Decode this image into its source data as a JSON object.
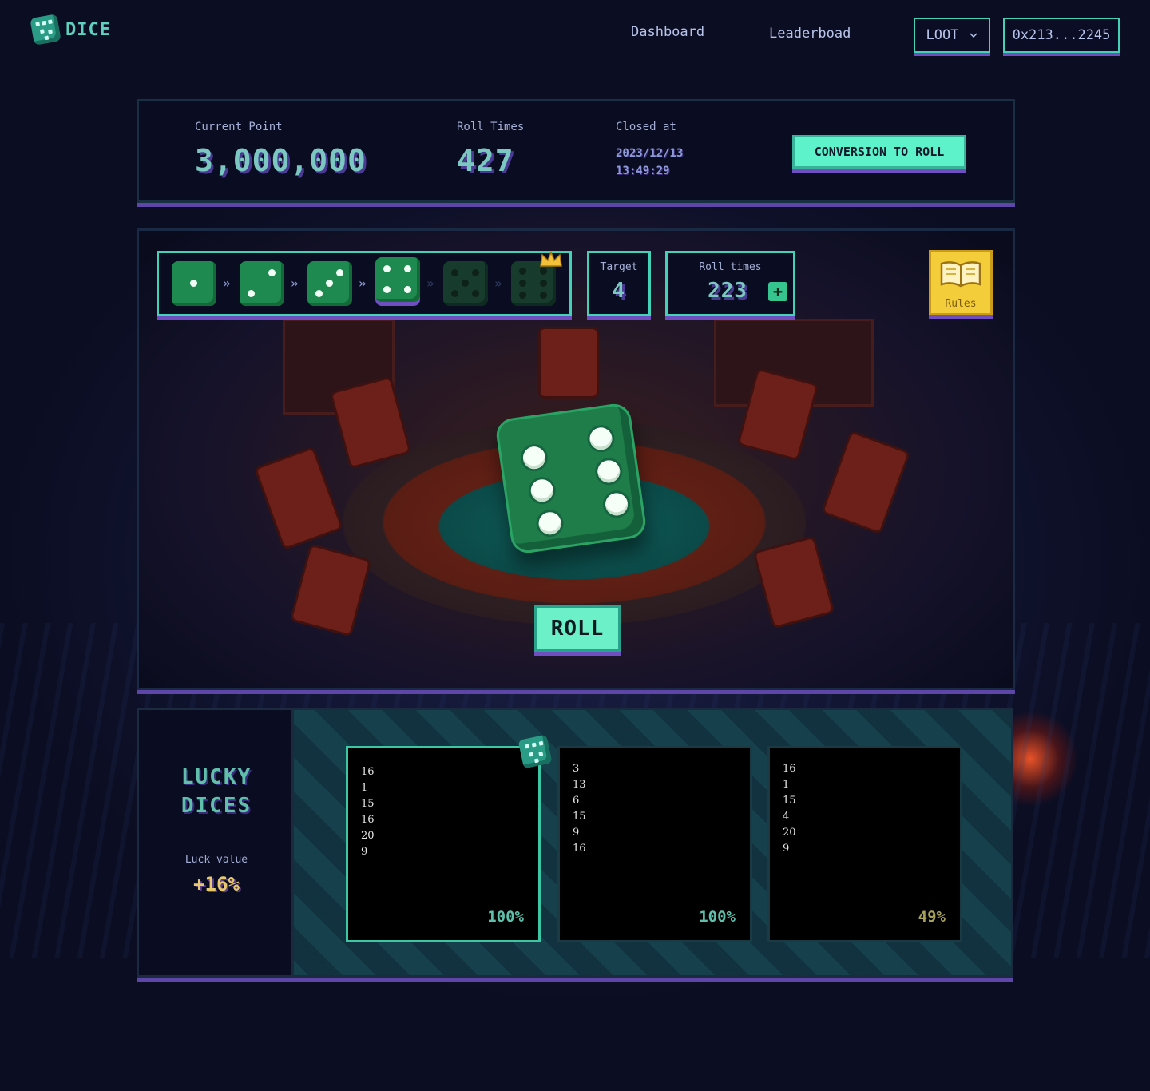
{
  "brand": {
    "name": "DICE",
    "logo_icon": "dice-icon"
  },
  "nav": {
    "links": [
      "Dashboard",
      "Leaderboad"
    ],
    "token_select": "LOOT",
    "wallet": "0x213...2245"
  },
  "stats": {
    "current_point_label": "Current Point",
    "current_point": "3,000,000",
    "roll_times_label": "Roll Times",
    "roll_times": "427",
    "closed_at_label": "Closed at",
    "closed_date": "2023/12/13",
    "closed_time": "13:49:29",
    "conversion_button": "CONVERSION TO ROLL"
  },
  "game": {
    "sequence": [
      1,
      2,
      3,
      4,
      5,
      6
    ],
    "current_step": 4,
    "target_label": "Target",
    "target": "4",
    "roll_times_label": "Roll times",
    "roll_times": "223",
    "rules_label": "Rules",
    "current_roll": 6,
    "roll_button": "ROLL"
  },
  "lucky": {
    "title_line1": "LUCKY",
    "title_line2": "DICES",
    "luck_label": "Luck value",
    "luck_value": "+16%",
    "cards": [
      {
        "numbers": [
          "16",
          "1",
          "15",
          "16",
          "20",
          "9"
        ],
        "percent": "100%",
        "selected": true
      },
      {
        "numbers": [
          "3",
          "13",
          "6",
          "15",
          "9",
          "16"
        ],
        "percent": "100%",
        "selected": false
      },
      {
        "numbers": [
          "16",
          "1",
          "15",
          "4",
          "20",
          "9"
        ],
        "percent": "49%",
        "selected": false
      }
    ]
  },
  "colors": {
    "accent": "#43d2b7",
    "shadow_purple": "#6e4ec0",
    "die_green": "#1f8a4f",
    "gold": "#f4cd3a"
  }
}
